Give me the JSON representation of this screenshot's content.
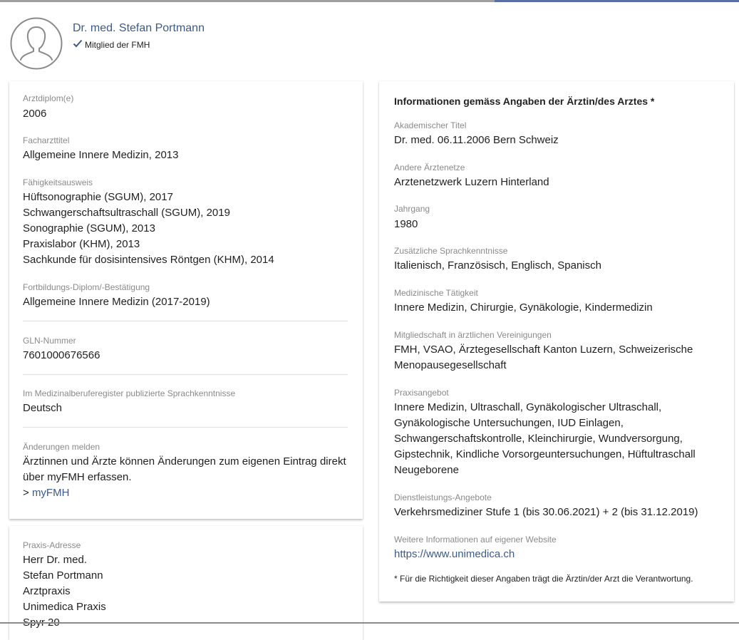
{
  "colors": {
    "accent": "#5b6fa6",
    "link": "#3c5a8a",
    "label": "#8a8a8a"
  },
  "profile": {
    "name": "Dr. med. Stefan Portmann",
    "membership": "Mitglied der FMH",
    "avatar_icon": "user-avatar-icon",
    "check_icon": "checkmark-icon"
  },
  "left": {
    "diploma_label": "Arztdiplom(e)",
    "diploma_value": "2006",
    "specialist_label": "Facharzttitel",
    "specialist_value": "Allgemeine Innere Medizin, 2013",
    "capability_label": "Fähigkeitsausweis",
    "capability_values": [
      "Hüftsonographie (SGUM), 2017",
      "Schwangerschaftsultraschall (SGUM), 2019",
      "Sonographie (SGUM), 2013",
      "Praxislabor (KHM), 2013",
      "Sachkunde für dosisintensives Röntgen (KHM), 2014"
    ],
    "training_label": "Fortbildungs-Diplom/-Bestätigung",
    "training_value": "Allgemeine Innere Medizin (2017-2019)",
    "gln_label": "GLN-Nummer",
    "gln_value": "7601000676566",
    "languages_label": "Im Medizinalberuferegister publizierte Sprachkenntnisse",
    "languages_value": "Deutsch",
    "changes_label": "Änderungen melden",
    "changes_text_1": "Ärztinnen und Ärzte können Änderungen zum eigenen Eintrag direkt",
    "changes_text_2": "über myFMH erfassen.",
    "changes_link_prefix": "> ",
    "changes_link": "myFMH"
  },
  "address": {
    "label": "Praxis-Adresse",
    "lines": [
      "Herr Dr. med.",
      "Stefan Portmann",
      "Arztpraxis",
      "Unimedica Praxis",
      "Spyr 20"
    ]
  },
  "right": {
    "heading": "Informationen gemäss Angaben der Ärztin/des Arztes *",
    "academic_label": "Akademischer Titel",
    "academic_value": "Dr. med. 06.11.2006 Bern Schweiz",
    "networks_label": "Andere Ärztenetze",
    "networks_value": "Arztenetzwerk Luzern Hinterland",
    "year_label": "Jahrgang",
    "year_value": "1980",
    "extra_languages_label": "Zusätzliche Sprachkenntnisse",
    "extra_languages_value": "Italienisch, Französisch, Englisch, Spanisch",
    "medical_activity_label": "Medizinische Tätigkeit",
    "medical_activity_value": "Innere Medizin, Chirurgie, Gynäkologie, Kindermedizin",
    "membership_label": "Mitgliedschaft in ärztlichen Vereinigungen",
    "membership_lines": [
      "FMH, VSAO, Ärztegesellschaft Kanton Luzern, Schweizerische",
      "Menopausegesellschaft"
    ],
    "practice_offer_label": "Praxisangebot",
    "practice_offer_lines": [
      "Innere Medizin, Ultraschall, Gynäkologischer Ultraschall,",
      "Gynäkologische Untersuchungen, IUD Einlagen,",
      "Schwangerschaftskontrolle, Kleinchirurgie, Wundversorgung,",
      "Gipstechnik, Kindliche Vorsorgeuntersuchungen, Hüftultraschall",
      "Neugeborene"
    ],
    "services_label": "Dienstleistungs-Angebote",
    "services_value": "Verkehrsmediziner Stufe 1 (bis 30.06.2021) + 2 (bis 31.12.2019)",
    "website_label": "Weitere Informationen auf eigener Website",
    "website_value": "https://www.unimedica.ch",
    "footnote": "* Für die Richtigkeit dieser Angaben trägt die Ärztin/der Arzt die Verantwortung."
  }
}
